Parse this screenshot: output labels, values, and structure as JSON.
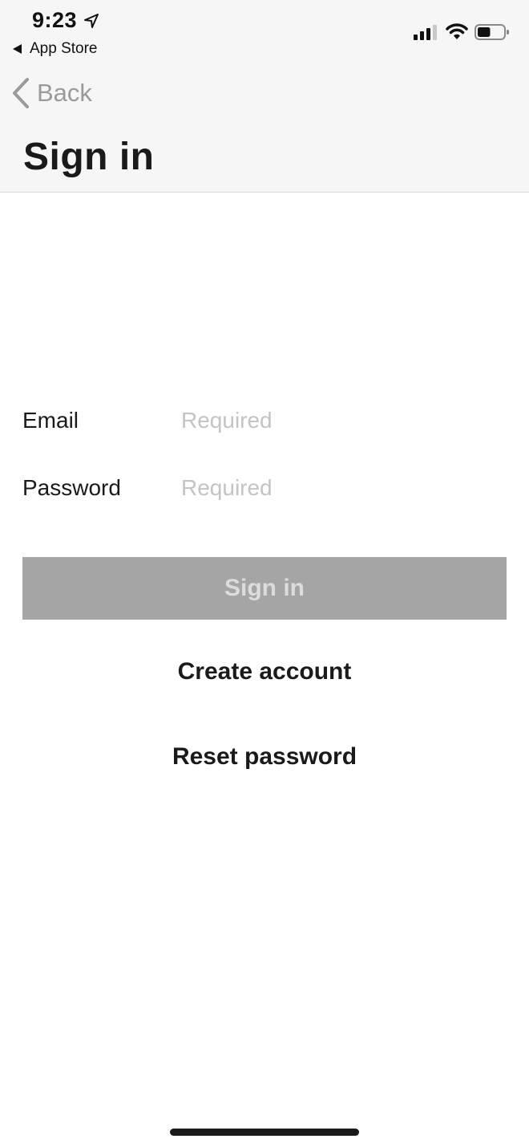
{
  "status_bar": {
    "time": "9:23",
    "back_app": "App Store"
  },
  "nav": {
    "back_label": "Back",
    "title": "Sign in"
  },
  "form": {
    "email_label": "Email",
    "email_placeholder": "Required",
    "password_label": "Password",
    "password_placeholder": "Required"
  },
  "actions": {
    "sign_in_label": "Sign in",
    "create_account_label": "Create account",
    "reset_password_label": "Reset password"
  },
  "colors": {
    "header_bg": "#f6f6f6",
    "disabled_button_bg": "#a5a5a5",
    "disabled_button_text": "#dcdcdc",
    "placeholder": "#c4c4c8"
  },
  "battery_level": 0.5
}
